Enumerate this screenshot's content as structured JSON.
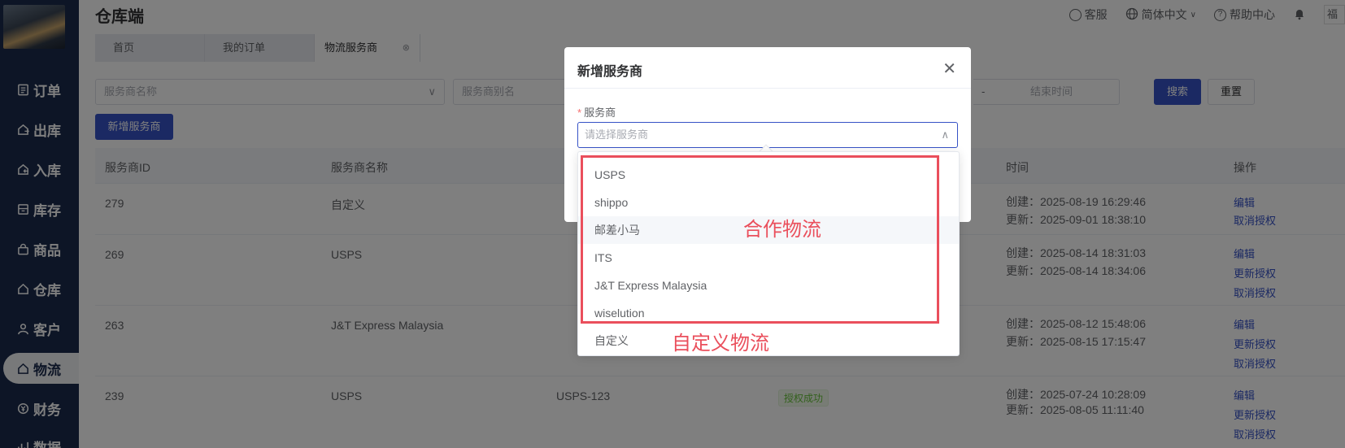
{
  "app": {
    "title": "仓库端"
  },
  "sidebar": {
    "items": [
      {
        "label": "订单",
        "icon": "list-icon"
      },
      {
        "label": "出库",
        "icon": "outbound-icon"
      },
      {
        "label": "入库",
        "icon": "inbound-icon"
      },
      {
        "label": "库存",
        "icon": "inventory-icon"
      },
      {
        "label": "商品",
        "icon": "bag-icon"
      },
      {
        "label": "仓库",
        "icon": "home-icon"
      },
      {
        "label": "客户",
        "icon": "user-icon"
      },
      {
        "label": "物流",
        "icon": "home-icon",
        "active": true
      },
      {
        "label": "财务",
        "icon": "finance-icon"
      },
      {
        "label": "数据",
        "icon": "chart-icon"
      }
    ]
  },
  "topbar": {
    "service": "客服",
    "language": "简体中文",
    "help": "帮助中心",
    "user_initial": "福"
  },
  "tabs": [
    {
      "label": "首页"
    },
    {
      "label": "我的订单"
    },
    {
      "label": "物流服务商",
      "active": true
    }
  ],
  "filters": {
    "provider_name_placeholder": "服务商名称",
    "provider_alias_placeholder": "服务商别名",
    "range_separator": "-",
    "end_time_placeholder": "结束时间",
    "search_label": "搜索",
    "reset_label": "重置",
    "add_label": "新增服务商"
  },
  "table": {
    "headers": [
      "服务商ID",
      "服务商名称",
      "时间",
      "操作"
    ],
    "rows": [
      {
        "id": "279",
        "name": "自定义",
        "alias": "",
        "status": "",
        "created": "创建：2025-08-19 16:29:46",
        "updated": "更新：2025-09-01 18:38:10",
        "actions": [
          "编辑",
          "取消授权"
        ]
      },
      {
        "id": "269",
        "name": "USPS",
        "alias": "",
        "status": "",
        "created": "创建：2025-08-14 18:31:03",
        "updated": "更新：2025-08-14 18:34:06",
        "actions": [
          "编辑",
          "更新授权",
          "取消授权"
        ]
      },
      {
        "id": "263",
        "name": "J&T Express Malaysia",
        "alias": "",
        "status": "",
        "created": "创建：2025-08-12 15:48:06",
        "updated": "更新：2025-08-15 17:15:47",
        "actions": [
          "编辑",
          "更新授权",
          "取消授权"
        ]
      },
      {
        "id": "239",
        "name": "USPS",
        "alias": "USPS-123",
        "status": "授权成功",
        "created": "创建：2025-07-24 10:28:09",
        "updated": "更新：2025-08-05 11:11:40",
        "actions": [
          "编辑",
          "更新授权",
          "取消授权"
        ]
      }
    ]
  },
  "dialog": {
    "title": "新增服务商",
    "field_label": "服务商",
    "required_mark": "*",
    "field_placeholder": "请选择服务商",
    "options": [
      "USPS",
      "shippo",
      "邮差小马",
      "ITS",
      "J&T Express Malaysia",
      "wiselution",
      "自定义"
    ],
    "hover_index": 2
  },
  "annotations": {
    "partner_label": "合作物流",
    "custom_label": "自定义物流",
    "color": "#ea4f5c"
  },
  "colors": {
    "primary": "#3652c6",
    "sidebar": "#1a2a4c",
    "success": "#67c23a"
  }
}
